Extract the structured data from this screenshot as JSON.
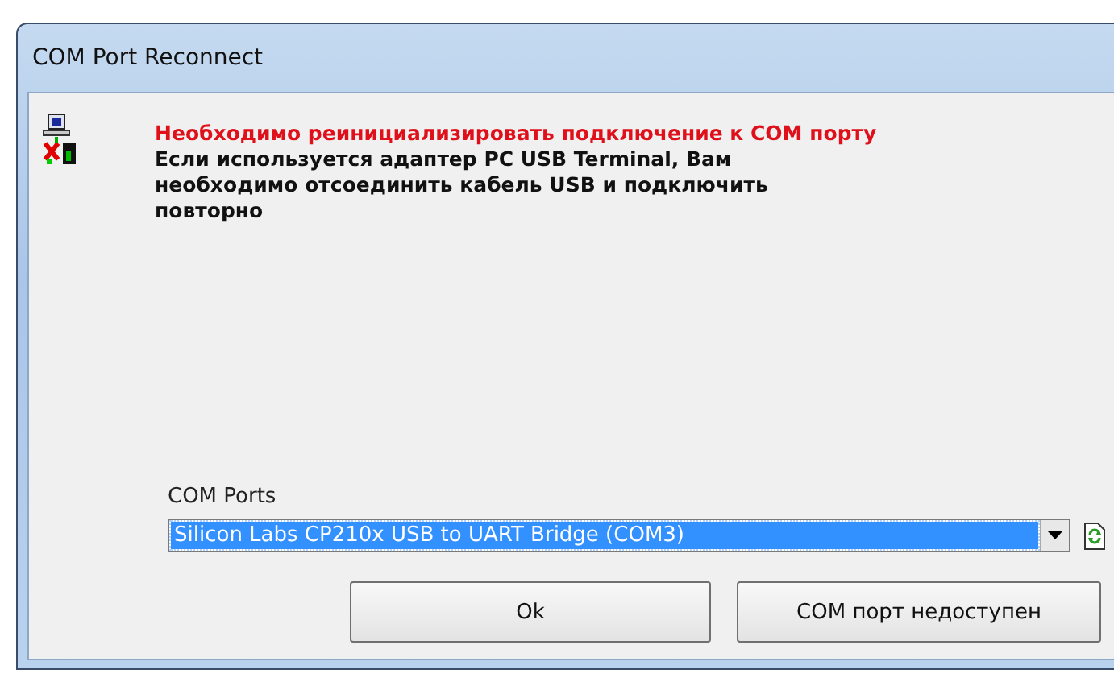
{
  "window": {
    "title": "COM Port Reconnect"
  },
  "message": {
    "headline": "Необходимо реинициализировать подключение к COM порту",
    "body": "Если используется адаптер PC USB Terminal, Вам необходимо отсоединить кабель USB и подключить повторно"
  },
  "com_ports": {
    "label": "COM Ports",
    "value": "Silicon Labs CP210x USB to UART Bridge (COM3)"
  },
  "buttons": [
    "Ok",
    "COM порт недоступен"
  ]
}
